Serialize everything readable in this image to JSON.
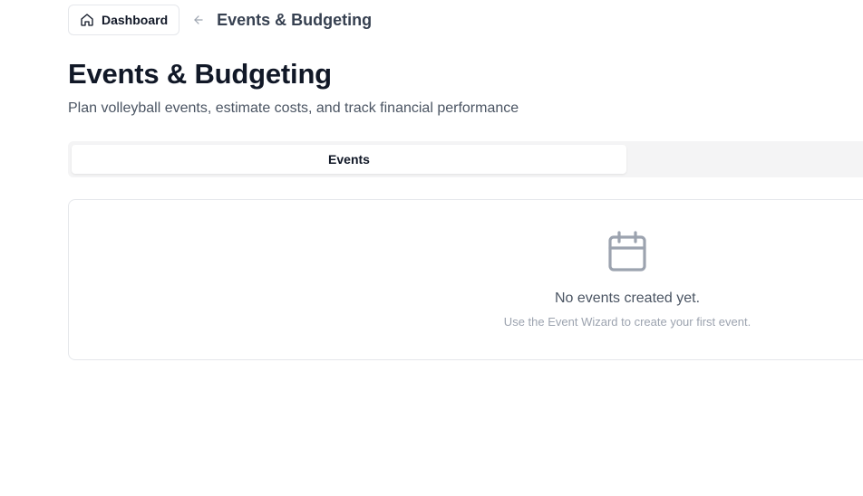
{
  "breadcrumb": {
    "home_label": "Dashboard",
    "current": "Events & Budgeting"
  },
  "header": {
    "title": "Events & Budgeting",
    "subtitle": "Plan volleyball events, estimate costs, and track financial performance"
  },
  "tabs": [
    {
      "label": "Events",
      "active": true
    }
  ],
  "empty_state": {
    "icon": "calendar-icon",
    "title": "No events created yet.",
    "hint": "Use the Event Wizard to create your first event."
  },
  "icons": {
    "home": "home-icon",
    "back": "arrow-left-icon"
  },
  "colors": {
    "text_primary": "#111827",
    "text_secondary": "#4b5563",
    "text_muted": "#9ca3af",
    "border": "#e5e7eb",
    "tabs_bg": "#f4f4f5",
    "icon_gray": "#9ca3af"
  }
}
